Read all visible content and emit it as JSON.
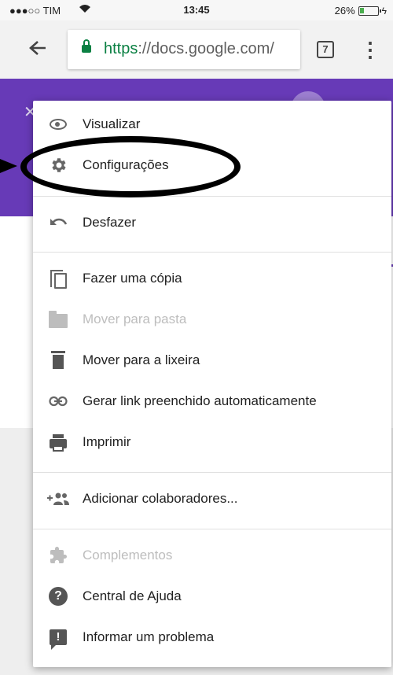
{
  "status_bar": {
    "carrier": "●●●○○ TIM",
    "wifi_icon": "wifi-icon",
    "time": "13:45",
    "battery_percent": "26%",
    "battery_level": 0.26
  },
  "browser": {
    "back_icon": "arrow-left-icon",
    "url_scheme": "https",
    "url_rest": "://docs.google.com/",
    "lock_icon": "lock-icon",
    "tab_count": "7",
    "menu_icon": "overflow-menu-icon"
  },
  "page": {
    "header_color": "#673ab7"
  },
  "menu": {
    "items": [
      {
        "label": "Visualizar",
        "icon": "eye-icon",
        "disabled": false
      },
      {
        "label": "Configurações",
        "icon": "gear-icon",
        "disabled": false
      },
      {
        "label": "Desfazer",
        "icon": "undo-icon",
        "disabled": false
      },
      {
        "label": "Fazer uma cópia",
        "icon": "copy-icon",
        "disabled": false
      },
      {
        "label": "Mover para pasta",
        "icon": "folder-icon",
        "disabled": true
      },
      {
        "label": "Mover para a lixeira",
        "icon": "trash-icon",
        "disabled": false
      },
      {
        "label": "Gerar link preenchido automaticamente",
        "icon": "link-icon",
        "disabled": false
      },
      {
        "label": "Imprimir",
        "icon": "print-icon",
        "disabled": false
      },
      {
        "label": "Adicionar colaboradores...",
        "icon": "add-people-icon",
        "disabled": false
      },
      {
        "label": "Complementos",
        "icon": "puzzle-icon",
        "disabled": true
      },
      {
        "label": "Central de Ajuda",
        "icon": "help-icon",
        "disabled": false
      },
      {
        "label": "Informar um problema",
        "icon": "report-icon",
        "disabled": false
      }
    ]
  }
}
